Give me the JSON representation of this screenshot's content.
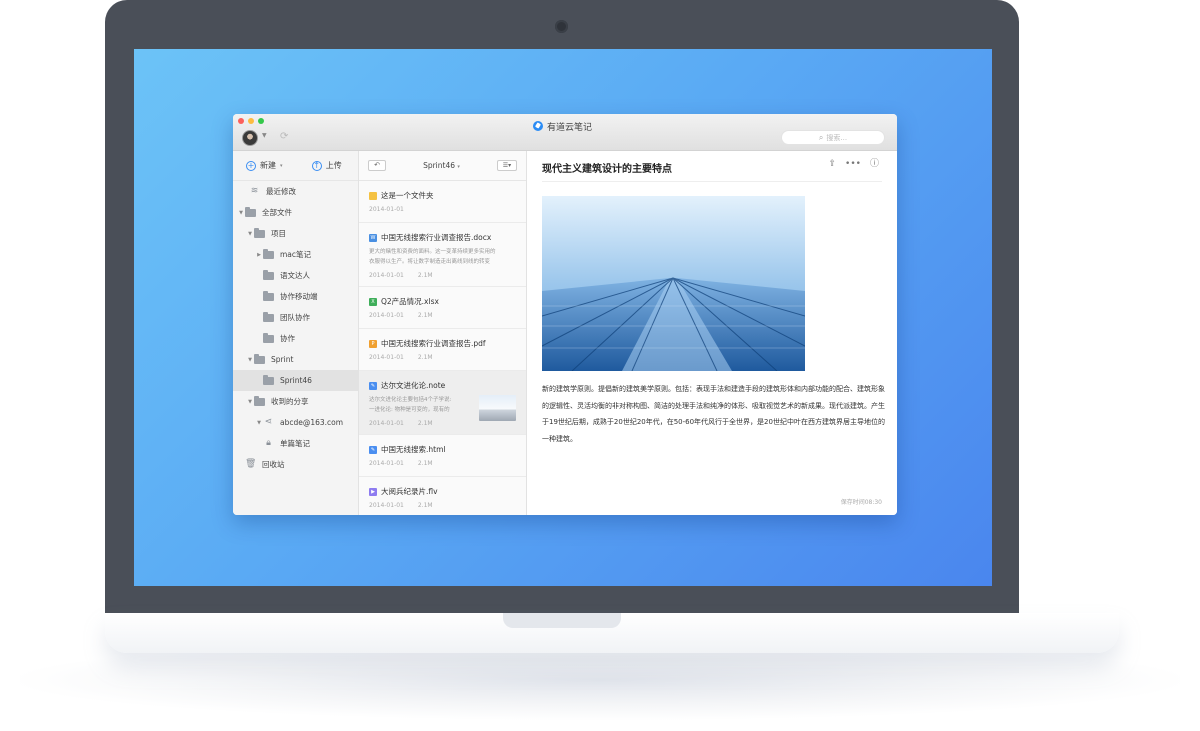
{
  "app": {
    "title": "有道云笔记",
    "search_placeholder": "搜索..."
  },
  "sidebar": {
    "new_label": "新建",
    "upload_label": "上传",
    "items": [
      {
        "label": "最近修改",
        "icon": "layers-icon"
      },
      {
        "label": "全部文件",
        "icon": "folder-icon"
      },
      {
        "label": "项目",
        "icon": "folder-icon"
      },
      {
        "label": "mac笔记",
        "icon": "folder-icon"
      },
      {
        "label": "语文达人",
        "icon": "folder-icon"
      },
      {
        "label": "协作移动端",
        "icon": "folder-icon"
      },
      {
        "label": "团队协作",
        "icon": "folder-icon"
      },
      {
        "label": "协作",
        "icon": "folder-icon"
      },
      {
        "label": "Sprint",
        "icon": "folder-icon"
      },
      {
        "label": "Sprint46",
        "icon": "folder-icon"
      },
      {
        "label": "收到的分享",
        "icon": "folder-icon"
      },
      {
        "label": "abcde@163.com",
        "icon": "share-icon"
      },
      {
        "label": "单篇笔记",
        "icon": "lock-icon"
      },
      {
        "label": "回收站",
        "icon": "trash-icon"
      }
    ]
  },
  "notelist": {
    "title": "Sprint46",
    "notes": [
      {
        "title": "这是一个文件夹",
        "date": "2014-01-01",
        "size": "",
        "type": "folder",
        "color": "#f5c242"
      },
      {
        "title": "中国无线搜索行业调查报告.docx",
        "snippet1": "更大的赌性和资费的面料。这一变革持续更多实用的",
        "snippet2": "衣服得以生产。将让数字制造走出离线到线的转变",
        "date": "2014-01-01",
        "size": "2.1M",
        "type": "docx",
        "color": "#4a90e2"
      },
      {
        "title": "Q2产品情况.xlsx",
        "date": "2014-01-01",
        "size": "2.1M",
        "type": "xlsx",
        "color": "#3fae5a"
      },
      {
        "title": "中国无线搜索行业调查报告.pdf",
        "date": "2014-01-01",
        "size": "2.1M",
        "type": "pdf",
        "color": "#f0a030"
      },
      {
        "title": "达尔文进化论.note",
        "snippet1": "达尔文进化论主要包括4个子学说:",
        "snippet2": "一进化论: 物种是可变的，现有的",
        "date": "2014-01-01",
        "size": "2.1M",
        "type": "note",
        "color": "#4a8ef0"
      },
      {
        "title": "中国无线搜索.html",
        "date": "2014-01-01",
        "size": "2.1M",
        "type": "html",
        "color": "#4a8ef0"
      },
      {
        "title": "大阅兵纪录片.flv",
        "date": "2014-01-01",
        "size": "2.1M",
        "type": "flv",
        "color": "#8e7cf0"
      }
    ]
  },
  "editor": {
    "title": "现代主义建筑设计的主要特点",
    "body": "新的建筑学原则。提倡新的建筑美学原则。包括：表现手法和建造手段的建筑形体和内部功能的配合、建筑形象的逻辑性、灵活均衡的非对称构图、简洁的处理手法和纯净的体形、吸取视觉艺术的新成果。现代派建筑。产生于19世纪后期，成熟于20世纪20年代，在50-60年代风行于全世界，是20世纪中叶在西方建筑界居主导地位的一种建筑。",
    "save_time": "保存时间08:30"
  }
}
